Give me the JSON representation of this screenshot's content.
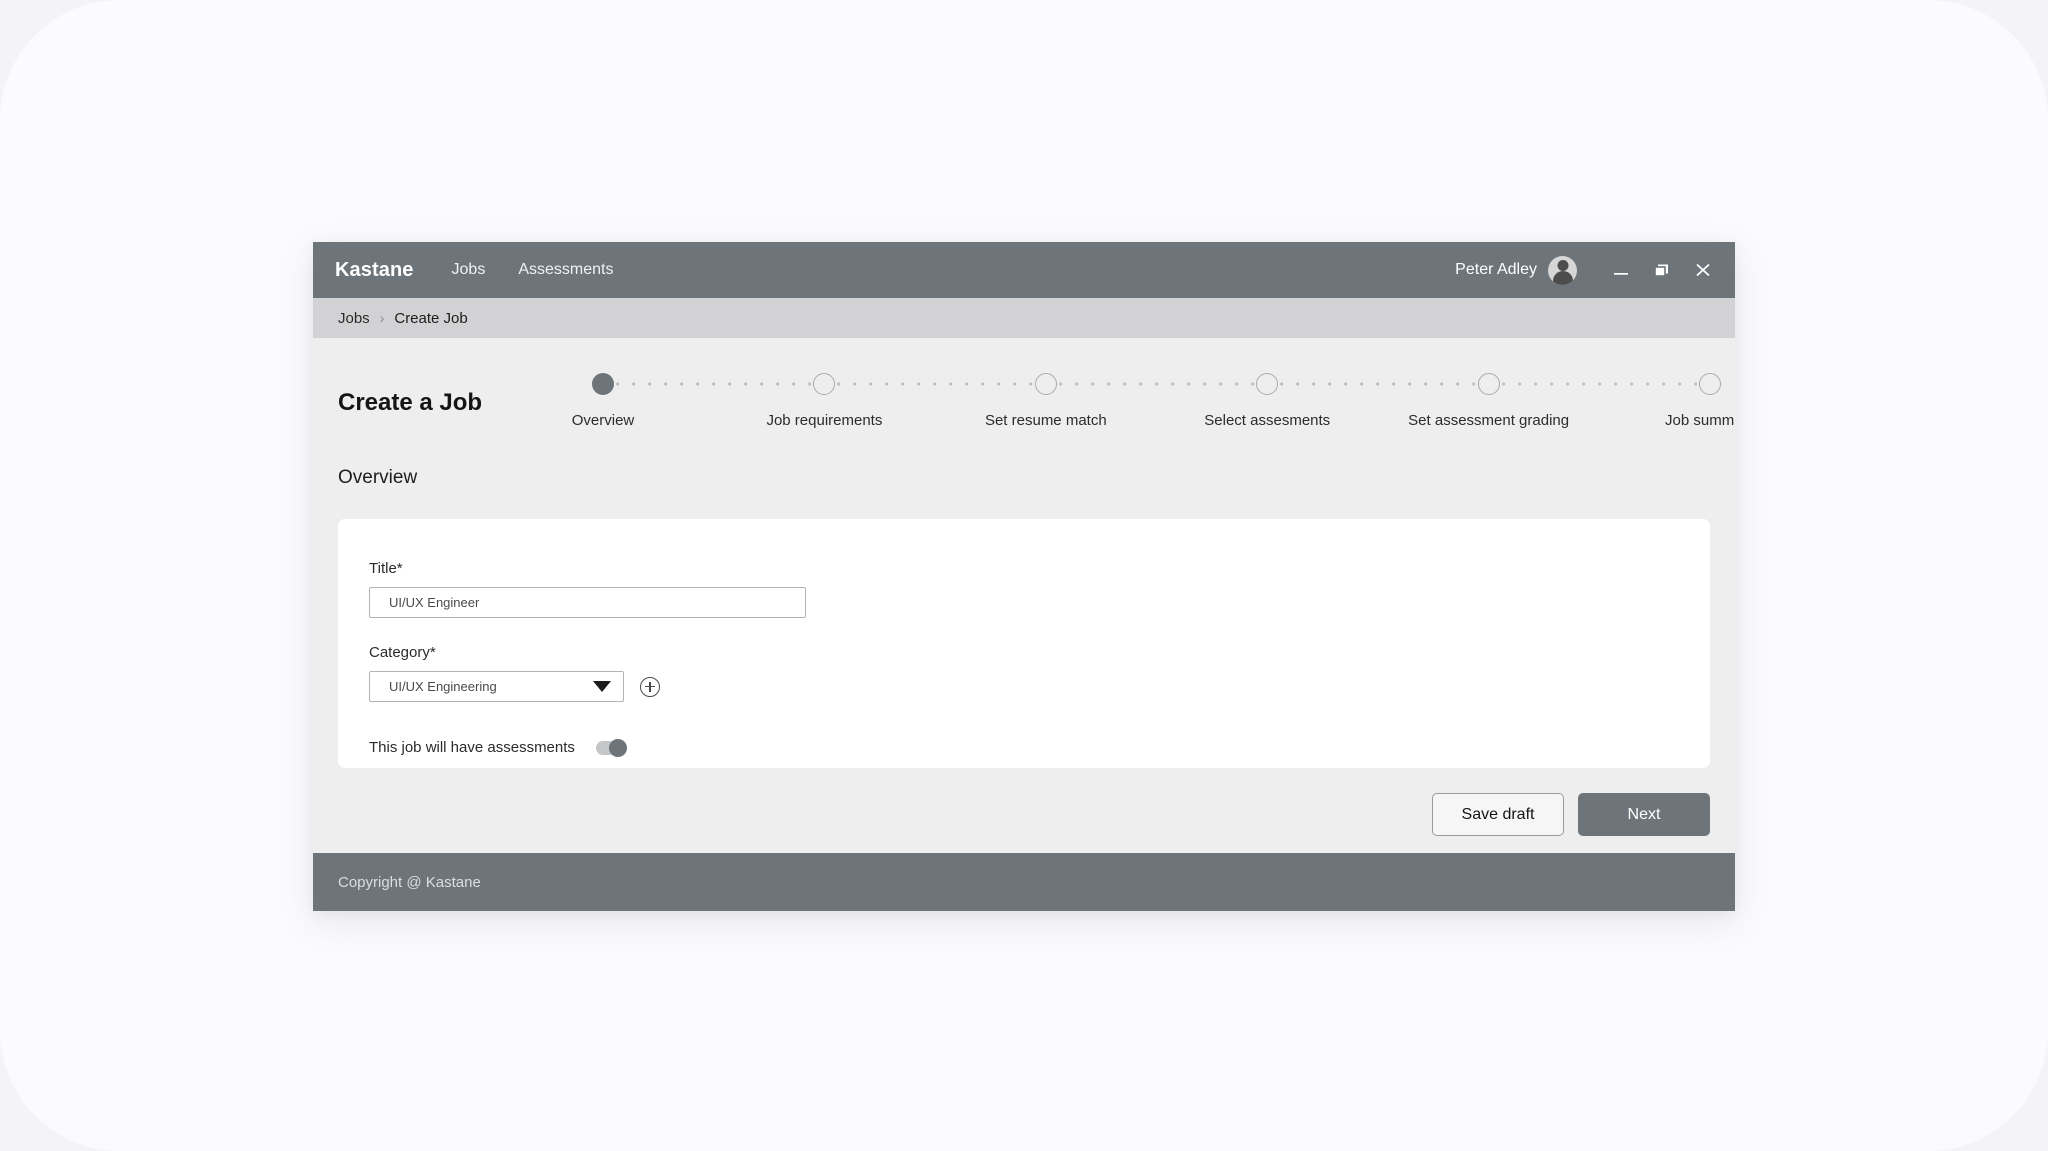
{
  "window": {
    "brand": "Kastane",
    "nav": [
      {
        "label": "Jobs",
        "name": "nav-link-jobs"
      },
      {
        "label": "Assessments",
        "name": "nav-link-assessments"
      }
    ],
    "user": {
      "name": "Peter Adley"
    },
    "controls": {
      "minimize": "minimize",
      "restore": "restore",
      "close": "close"
    }
  },
  "breadcrumb": {
    "items": [
      "Jobs",
      "Create Job"
    ],
    "separator": "›"
  },
  "page": {
    "title": "Create a Job",
    "section_title": "Overview"
  },
  "stepper": {
    "active_index": 0,
    "steps": [
      {
        "label": "Overview"
      },
      {
        "label": "Job requirements"
      },
      {
        "label": "Set resume match"
      },
      {
        "label": "Select assesments"
      },
      {
        "label": "Set assessment grading"
      },
      {
        "label": "Job summary"
      }
    ]
  },
  "form": {
    "title_field": {
      "label": "Title*",
      "value": "UI/UX Engineer",
      "placeholder": "UI/UX Engineer"
    },
    "category_field": {
      "label": "Category*",
      "value": "UI/UX Engineering",
      "add_label": "add-category"
    },
    "assessments_toggle": {
      "label": "This job will have assessments",
      "state": "on"
    }
  },
  "actions": {
    "save_draft_label": "Save draft",
    "next_label": "Next"
  },
  "footer": {
    "copyright": "Copyright @ Kastane"
  },
  "colors": {
    "chrome": "#6d757a",
    "breadcrumb_bar": "#d2d2d4",
    "content_bg": "#eeeeee",
    "card_bg": "#ffffff",
    "page_bg": "#fbfbfd",
    "outer_bg": "#f4f4f8"
  }
}
